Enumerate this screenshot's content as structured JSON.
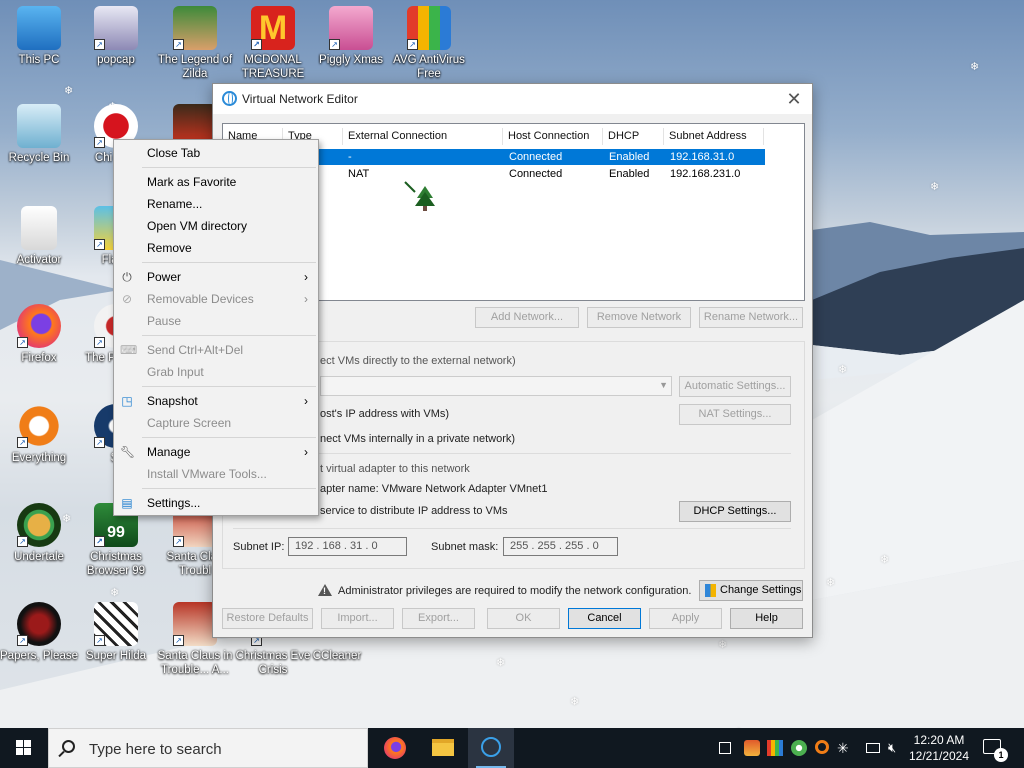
{
  "desktop": {
    "icons": [
      {
        "label": "This PC"
      },
      {
        "label": "popcap"
      },
      {
        "label": "The Legend of Zilda"
      },
      {
        "label": "MCDONAL TREASURE"
      },
      {
        "label": "Piggly Xmas"
      },
      {
        "label": "AVG AntiVirus Free"
      },
      {
        "label": "Recycle Bin"
      },
      {
        "label": "Chi Inva"
      },
      {
        "label": "Activator"
      },
      {
        "label": "Flapp"
      },
      {
        "label": "Firefox"
      },
      {
        "label": "The P Mach"
      },
      {
        "label": "Everything"
      },
      {
        "label": "St"
      },
      {
        "label": "Undertale"
      },
      {
        "label": "Christmas Browser 99"
      },
      {
        "label": "Santa Clau Troubl"
      },
      {
        "label": "Papers, Please"
      },
      {
        "label": "Super Hilda"
      },
      {
        "label": "Santa Claus in Trouble... A..."
      },
      {
        "label": "Christmas Eve Crisis"
      },
      {
        "label": "CCleaner"
      }
    ]
  },
  "dialog": {
    "title": "Virtual Network Editor",
    "columns": [
      "Name",
      "Type",
      "External Connection",
      "Host Connection",
      "DHCP",
      "Subnet Address"
    ],
    "rows": [
      {
        "name": "",
        "type": "nly",
        "external": "-",
        "host": "Connected",
        "dhcp": "Enabled",
        "subnet": "192.168.31.0",
        "selected": true
      },
      {
        "name": "",
        "type": "",
        "external": "NAT",
        "host": "Connected",
        "dhcp": "Enabled",
        "subnet": "192.168.231.0",
        "selected": false
      }
    ],
    "buttons": {
      "add_network": "Add Network...",
      "remove_network": "Remove Network",
      "rename_network": "Rename Network...",
      "automatic_settings": "Automatic Settings...",
      "nat_settings": "NAT Settings...",
      "dhcp_settings": "DHCP Settings...",
      "change_settings": "Change Settings",
      "restore_defaults": "Restore Defaults",
      "import": "Import...",
      "export": "Export...",
      "ok": "OK",
      "cancel": "Cancel",
      "apply": "Apply",
      "help": "Help"
    },
    "options": {
      "bridged": "ect VMs directly to the external network)",
      "nat": "ost's IP address with VMs)",
      "host_only": "nect VMs internally in a private network)",
      "connect_adapter": "t virtual adapter to this network",
      "adapter_name": "apter name: VMware Network Adapter VMnet1",
      "dhcp_service": "service to distribute IP address to VMs"
    },
    "subnet_ip_label": "Subnet IP:",
    "subnet_ip_value": "192 . 168 . 31 . 0",
    "subnet_mask_label": "Subnet mask:",
    "subnet_mask_value": "255 . 255 . 255 . 0",
    "admin_warning": "Administrator privileges are required to modify the network configuration."
  },
  "context_menu": {
    "items": [
      {
        "label": "Close Tab",
        "enabled": true
      },
      {
        "label": "Mark as Favorite",
        "enabled": true
      },
      {
        "label": "Rename...",
        "enabled": true
      },
      {
        "label": "Open VM directory",
        "enabled": true
      },
      {
        "label": "Remove",
        "enabled": true
      },
      {
        "label": "Power",
        "enabled": true,
        "icon": "power-icon"
      },
      {
        "label": "Removable Devices",
        "enabled": false,
        "icon": "removable-devices-icon"
      },
      {
        "label": "Pause",
        "enabled": false
      },
      {
        "label": "Send Ctrl+Alt+Del",
        "enabled": false,
        "icon": "keyboard-icon"
      },
      {
        "label": "Grab Input",
        "enabled": false
      },
      {
        "label": "Snapshot",
        "enabled": true,
        "icon": "snapshot-icon"
      },
      {
        "label": "Capture Screen",
        "enabled": false
      },
      {
        "label": "Manage",
        "enabled": true,
        "icon": "wrench-icon"
      },
      {
        "label": "Install VMware Tools...",
        "enabled": false
      },
      {
        "label": "Settings...",
        "enabled": true,
        "icon": "settings-icon"
      }
    ]
  },
  "taskbar": {
    "search_placeholder": "Type here to search",
    "time": "12:20 AM",
    "date": "12/21/2024",
    "notification_count": "1"
  },
  "colors": {
    "selection": "#0078d7",
    "taskbar": "#101820"
  }
}
